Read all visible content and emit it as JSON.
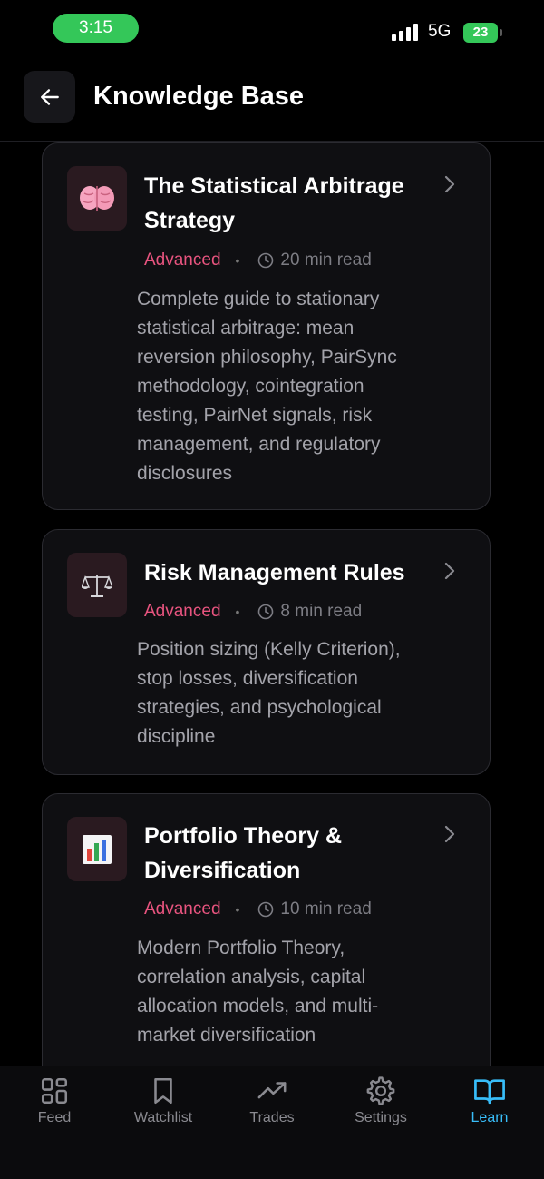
{
  "status_bar": {
    "time": "3:15",
    "network": "5G",
    "battery": "23"
  },
  "header": {
    "title": "Knowledge Base"
  },
  "articles": [
    {
      "icon": "brain-icon",
      "title_lines": [
        "The Statistical Arbitrage",
        "Strategy"
      ],
      "level": "Advanced",
      "read_time": "20 min read",
      "description_lines": [
        "Complete guide to stationary",
        "statistical arbitrage: mean",
        "reversion philosophy, PairSync",
        "methodology, cointegration",
        "testing, PairNet signals, risk",
        "management, and regulatory",
        "disclosures"
      ]
    },
    {
      "icon": "balance-scale-icon",
      "title_lines": [
        "Risk Management Rules"
      ],
      "level": "Advanced",
      "read_time": "8 min read",
      "description_lines": [
        "Position sizing (Kelly Criterion),",
        "stop losses, diversification",
        "strategies, and psychological",
        "discipline"
      ]
    },
    {
      "icon": "bar-chart-icon",
      "title_lines": [
        "Portfolio Theory &",
        "Diversification"
      ],
      "level": "Advanced",
      "read_time": "10 min read",
      "description_lines": [
        "Modern Portfolio Theory,",
        "correlation analysis, capital",
        "allocation models, and multi-",
        "market diversification"
      ]
    }
  ],
  "bottom_nav": {
    "items": [
      {
        "label": "Feed",
        "icon": "grid-icon"
      },
      {
        "label": "Watchlist",
        "icon": "bookmark-icon"
      },
      {
        "label": "Trades",
        "icon": "trending-up-icon"
      },
      {
        "label": "Settings",
        "icon": "gear-icon"
      },
      {
        "label": "Learn",
        "icon": "book-open-icon"
      }
    ],
    "active": "Learn"
  },
  "colors": {
    "background": "#000000",
    "card": "#0f0f12",
    "accent_pink": "#e8547f",
    "active_tab": "#38bdf8",
    "status_green": "#34c759"
  }
}
